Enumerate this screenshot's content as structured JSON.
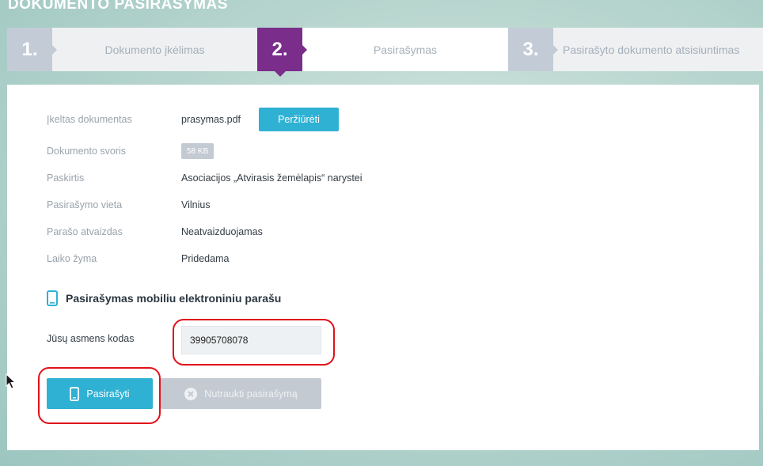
{
  "page_title": "DOKUMENTO PASIRAŠYMAS",
  "steps": [
    {
      "num": "1.",
      "label": "Dokumento įkėlimas",
      "active": false
    },
    {
      "num": "2.",
      "label": "Pasirašymas",
      "active": true
    },
    {
      "num": "3.",
      "label": "Pasirašyto dokumento atsisiuntimas",
      "active": false
    }
  ],
  "details": {
    "uploaded_doc_label": "Įkeltas dokumentas",
    "uploaded_doc_value": "prasymas.pdf",
    "view_button": "Peržiūrėti",
    "weight_label": "Dokumento svoris",
    "weight_value": "58 KB",
    "purpose_label": "Paskirtis",
    "purpose_value": "Asociacijos „Atvirasis žemėlapis“ narystei",
    "place_label": "Pasirašymo vieta",
    "place_value": "Vilnius",
    "signature_image_label": "Parašo atvaizdas",
    "signature_image_value": "Neatvaizduojamas",
    "timestamp_label": "Laiko žyma",
    "timestamp_value": "Pridedama"
  },
  "mobile_section": {
    "title": "Pasirašymas mobiliu elektroniniu parašu",
    "personal_code_label": "Jūsų asmens kodas",
    "personal_code_value": "39905708078",
    "sign_button": "Pasirašyti",
    "cancel_button": "Nutraukti pasirašymą"
  },
  "colors": {
    "accent": "#2eb1d3",
    "active_step": "#7a2d8a",
    "inactive_step": "#c3ccd6",
    "highlight": "#e0111a"
  },
  "icons": {
    "section": "mobile-phone-icon",
    "sign": "mobile-phone-icon",
    "cancel": "close-circle-icon",
    "cursor": "mouse-cursor-icon"
  }
}
